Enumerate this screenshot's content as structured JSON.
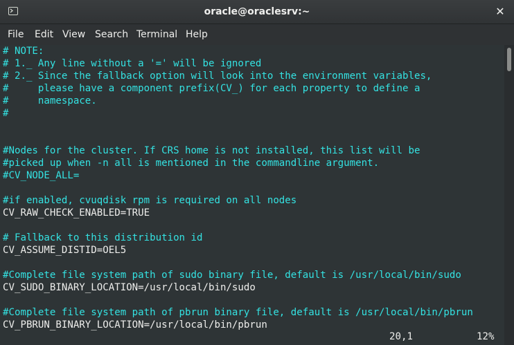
{
  "window": {
    "title": "oracle@oraclesrv:~"
  },
  "menu": [
    "File",
    "Edit",
    "View",
    "Search",
    "Terminal",
    "Help"
  ],
  "terminal": {
    "lines": [
      {
        "text": "# NOTE:",
        "type": "comment"
      },
      {
        "text": "# 1._ Any line without a '=' will be ignored",
        "type": "comment"
      },
      {
        "text": "# 2._ Since the fallback option will look into the environment variables,",
        "type": "comment"
      },
      {
        "text": "#     please have a component prefix(CV_) for each property to define a",
        "type": "comment"
      },
      {
        "text": "#     namespace.",
        "type": "comment"
      },
      {
        "text": "#",
        "type": "comment"
      },
      {
        "text": "",
        "type": "blank"
      },
      {
        "text": "",
        "type": "blank"
      },
      {
        "text": "#Nodes for the cluster. If CRS home is not installed, this list will be",
        "type": "comment"
      },
      {
        "text": "#picked up when -n all is mentioned in the commandline argument.",
        "type": "comment"
      },
      {
        "text": "#CV_NODE_ALL=",
        "type": "comment"
      },
      {
        "text": "",
        "type": "blank"
      },
      {
        "text": "#if enabled, cvuqdisk rpm is required on all nodes",
        "type": "comment"
      },
      {
        "text": "CV_RAW_CHECK_ENABLED=TRUE",
        "type": "code"
      },
      {
        "text": "",
        "type": "blank"
      },
      {
        "text": "# Fallback to this distribution id",
        "type": "comment"
      },
      {
        "text": "CV_ASSUME_DISTID=OEL5",
        "type": "code"
      },
      {
        "text": "",
        "type": "blank"
      },
      {
        "text": "#Complete file system path of sudo binary file, default is /usr/local/bin/sudo",
        "type": "comment"
      },
      {
        "text": "CV_SUDO_BINARY_LOCATION=/usr/local/bin/sudo",
        "type": "code"
      },
      {
        "text": "",
        "type": "blank"
      },
      {
        "text": "#Complete file system path of pbrun binary file, default is /usr/local/bin/pbrun",
        "type": "comment"
      },
      {
        "text": "CV_PBRUN_BINARY_LOCATION=/usr/local/bin/pbrun",
        "type": "code"
      }
    ],
    "status": {
      "position": "20,1",
      "percent": "12%"
    }
  },
  "icons": {
    "terminal": "terminal-icon",
    "close": "close-icon"
  },
  "colors": {
    "background": "#2e3436",
    "comment": "#34e2e2",
    "text": "#eeeeec"
  }
}
